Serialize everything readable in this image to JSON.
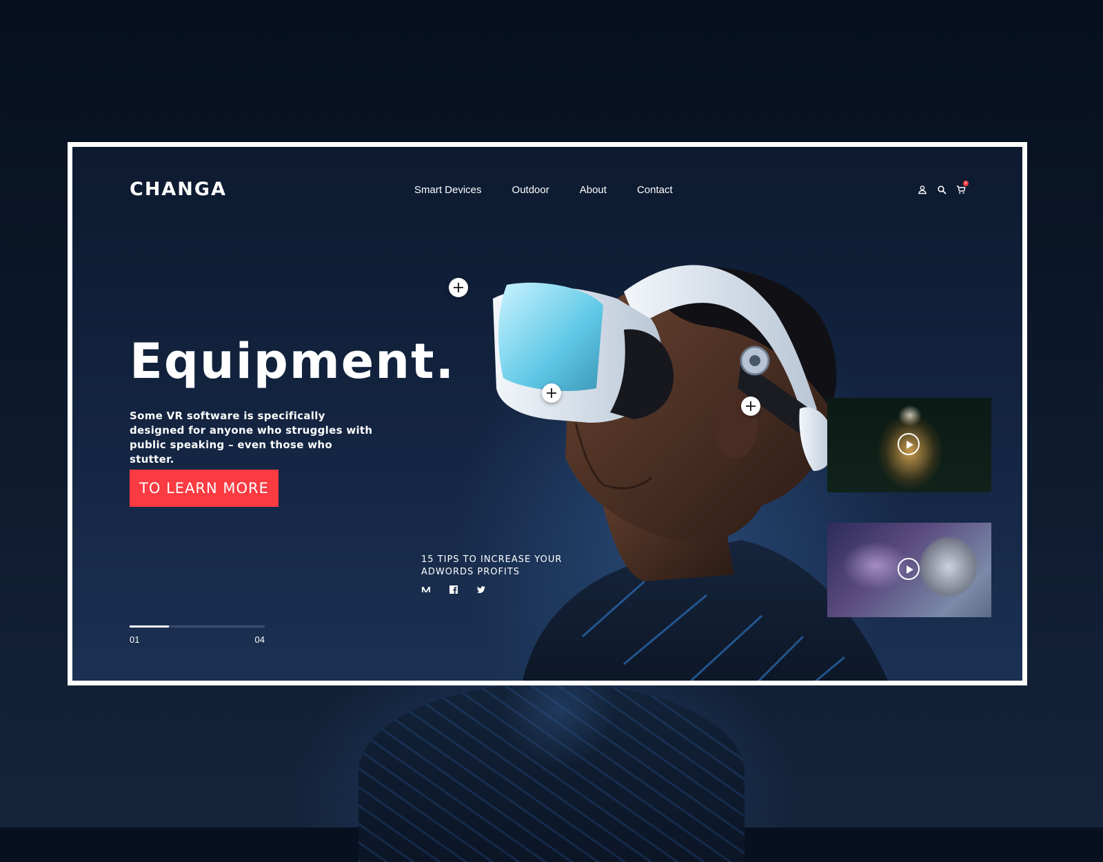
{
  "header": {
    "logo": "CHANGA",
    "nav": [
      {
        "label": "Smart Devices"
      },
      {
        "label": "Outdoor"
      },
      {
        "label": "About"
      },
      {
        "label": "Contact"
      }
    ],
    "icons": [
      "user-icon",
      "search-icon",
      "cart-icon"
    ],
    "cart_count": "2"
  },
  "hero": {
    "headline": "Equipment.",
    "description": "Some VR software is specifically designed for anyone who struggles with public speaking – even those who stutter.",
    "cta_label": "TO LEARN MORE"
  },
  "article": {
    "title": "15 TIPS TO INCREASE YOUR ADWORDS PROFITS",
    "share_icons": [
      "medium-icon",
      "facebook-icon",
      "twitter-icon"
    ]
  },
  "slider": {
    "current": "01",
    "total": "04",
    "progress": 0.29
  },
  "colors": {
    "accent": "#fa3b42",
    "background": "#0d1a2f",
    "frame": "#ffffff",
    "text": "#ffffff"
  }
}
